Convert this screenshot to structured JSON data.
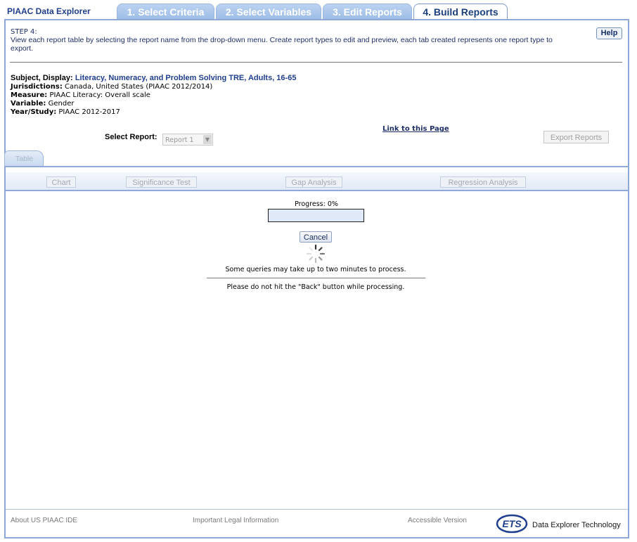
{
  "app_title": "PIAAC Data Explorer",
  "tabs": [
    {
      "label": "1. Select Criteria",
      "active": false
    },
    {
      "label": "2. Select Variables",
      "active": false
    },
    {
      "label": "3. Edit Reports",
      "active": false
    },
    {
      "label": "4. Build Reports",
      "active": true
    }
  ],
  "step": {
    "title": "STEP 4:",
    "description": "View each report table by selecting the report name from the drop-down menu. Create report types to edit and preview, each tab created represents one report type to export."
  },
  "help_label": "Help",
  "meta": {
    "subject_label": "Subject, Display:",
    "subject_value": "Literacy, Numeracy, and Problem Solving TRE, Adults, 16-65",
    "jurisdictions_label": "Jurisdictions:",
    "jurisdictions_value": "Canada, United States (PIAAC 2012/2014)",
    "measure_label": "Measure:",
    "measure_value": "PIAAC Literacy: Overall scale",
    "variable_label": "Variable:",
    "variable_value": "Gender",
    "year_label": "Year/Study:",
    "year_value": "PIAAC 2012-2017"
  },
  "select_report": {
    "label": "Select Report:",
    "value": "Report 1"
  },
  "link_to_page": "Link to this Page",
  "export_label": "Export Reports",
  "report_tab": "Table",
  "sub_buttons": {
    "chart": "Chart",
    "significance": "Significance Test",
    "gap": "Gap Analysis",
    "regression": "Regression Analysis"
  },
  "progress": {
    "label": "Progress: 0%",
    "value": 0
  },
  "cancel_label": "Cancel",
  "messages": {
    "line1": "Some queries may take up to two minutes to process.",
    "line2": "Please do not hit the \"Back\" button while processing."
  },
  "footer": {
    "about": "About US PIAAC IDE",
    "legal": "Important Legal Information",
    "accessible": "Accessible Version",
    "logo_text": "ETS",
    "tech": "Data Explorer Technology"
  },
  "colors": {
    "brand_blue": "#1f3e8c",
    "tab_blue": "#9ebde6",
    "frame_border": "#8da8d6"
  }
}
